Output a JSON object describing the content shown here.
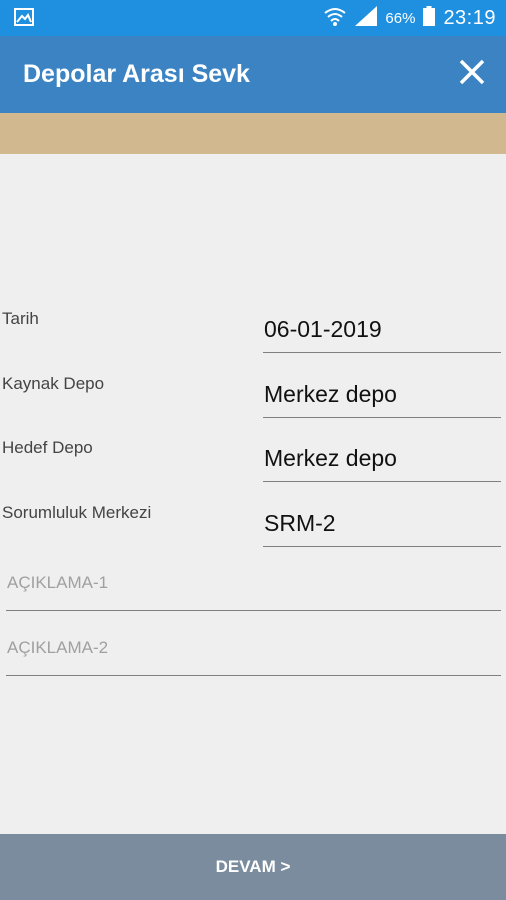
{
  "status_bar": {
    "battery_percent": "66%",
    "time": "23:19"
  },
  "app_bar": {
    "title": "Depolar Arası Sevk"
  },
  "form": {
    "fields": [
      {
        "label": "Tarih",
        "value": "06-01-2019"
      },
      {
        "label": "Kaynak Depo",
        "value": "Merkez depo"
      },
      {
        "label": "Hedef Depo",
        "value": "Merkez depo"
      },
      {
        "label": "Sorumluluk Merkezi",
        "value": "SRM-2"
      }
    ],
    "descriptions": [
      {
        "placeholder": "AÇIKLAMA-1"
      },
      {
        "placeholder": "AÇIKLAMA-2"
      }
    ]
  },
  "footer": {
    "continue_label": "DEVAM >"
  },
  "colors": {
    "status_bar": "#1f8fe0",
    "app_bar": "#3b83c3",
    "band": "#d2b88f",
    "button": "#7a8c9e",
    "background": "#efefef"
  },
  "icons": [
    "gallery-icon",
    "wifi-icon",
    "signal-icon",
    "battery-icon",
    "close-icon"
  ]
}
